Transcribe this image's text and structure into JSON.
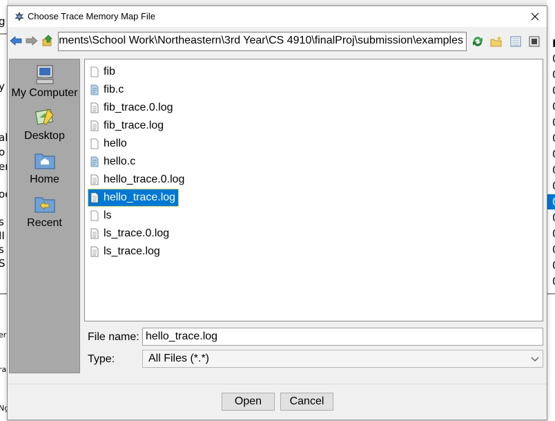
{
  "background": {
    "left_fragments": [
      "g",
      "y",
      "al",
      "o",
      "er",
      "oe",
      "s",
      "II",
      "s",
      "S",
      "er",
      "ra",
      "Ng"
    ],
    "right_fragments": [
      "N",
      "0",
      "0",
      "0",
      "0",
      "0",
      "0",
      "0",
      "0",
      "0",
      "0",
      "0",
      "0",
      "0",
      "0",
      "0",
      "0"
    ]
  },
  "dialog": {
    "title": "Choose Trace Memory Map File",
    "close_glyph": "✕"
  },
  "toolbar": {
    "path": "ments\\School Work\\Northeastern\\3rd Year\\CS 4910\\finalProj\\submission\\examples",
    "icons": [
      "back-arrow-icon",
      "forward-arrow-icon",
      "up-folder-icon",
      "refresh-icon",
      "new-folder-icon",
      "list-view-icon",
      "details-view-icon"
    ]
  },
  "places": [
    {
      "label": "My Computer",
      "icon": "computer-icon"
    },
    {
      "label": "Desktop",
      "icon": "desktop-icon"
    },
    {
      "label": "Home",
      "icon": "home-folder-icon"
    },
    {
      "label": "Recent",
      "icon": "recent-folder-icon"
    }
  ],
  "files": [
    {
      "name": "fib",
      "icon": "blank-file-icon"
    },
    {
      "name": "fib.c",
      "icon": "source-file-icon"
    },
    {
      "name": "fib_trace.0.log",
      "icon": "text-file-icon"
    },
    {
      "name": "fib_trace.log",
      "icon": "text-file-icon"
    },
    {
      "name": "hello",
      "icon": "blank-file-icon"
    },
    {
      "name": "hello.c",
      "icon": "source-file-icon"
    },
    {
      "name": "hello_trace.0.log",
      "icon": "text-file-icon"
    },
    {
      "name": "hello_trace.log",
      "icon": "text-file-icon",
      "selected": true
    },
    {
      "name": "ls",
      "icon": "blank-file-icon"
    },
    {
      "name": "ls_trace.0.log",
      "icon": "text-file-icon"
    },
    {
      "name": "ls_trace.log",
      "icon": "text-file-icon"
    }
  ],
  "form": {
    "file_name_label": "File name:",
    "file_name_value": "hello_trace.log",
    "type_label": "Type:",
    "type_value": "All Files (*.*)"
  },
  "buttons": {
    "open": "Open",
    "cancel": "Cancel"
  },
  "colors": {
    "selection": "#0078d7",
    "places_panel": "#a8a8a8",
    "dialog_bg": "#f0f0f0"
  }
}
